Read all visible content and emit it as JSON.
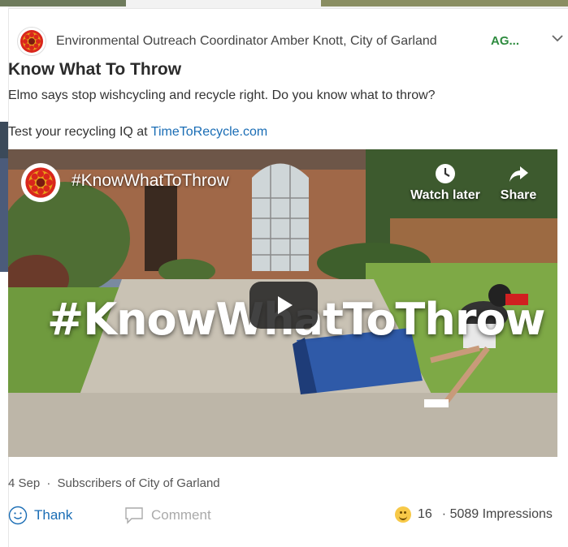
{
  "post": {
    "author": "Environmental Outreach Coordinator Amber Knott, City of Garland",
    "group_tag": "AG...",
    "title": "Know What To Throw",
    "body_line1": "Elmo says stop wishcycling and recycle right. Do you know what to throw?",
    "body_line2_prefix": "Test your recycling IQ at ",
    "body_link": "TimeToRecycle.com"
  },
  "video": {
    "channel_title": "#KnowWhatToThrow",
    "overlay_text": "#KnowWhatToThrow",
    "watch_later_label": "Watch later",
    "share_label": "Share"
  },
  "meta": {
    "date": "4 Sep",
    "separator": "·",
    "audience": "Subscribers of City of Garland"
  },
  "actions": {
    "thank_label": "Thank",
    "comment_label": "Comment",
    "reaction_count": "16",
    "impressions": "· 5089 Impressions"
  },
  "icons": {
    "avatar": "city-seal-icon",
    "chevron": "chevron-down-icon",
    "watch_later": "clock-icon",
    "share": "share-arrow-icon",
    "play": "play-icon",
    "thank": "smiley-icon",
    "comment": "comment-bubble-icon",
    "reaction": "smiley-emoji-icon"
  },
  "colors": {
    "link": "#1a6db5",
    "group_tag": "#2e8b3f",
    "seal_red": "#d9261c",
    "seal_gold": "#e8a11a"
  }
}
